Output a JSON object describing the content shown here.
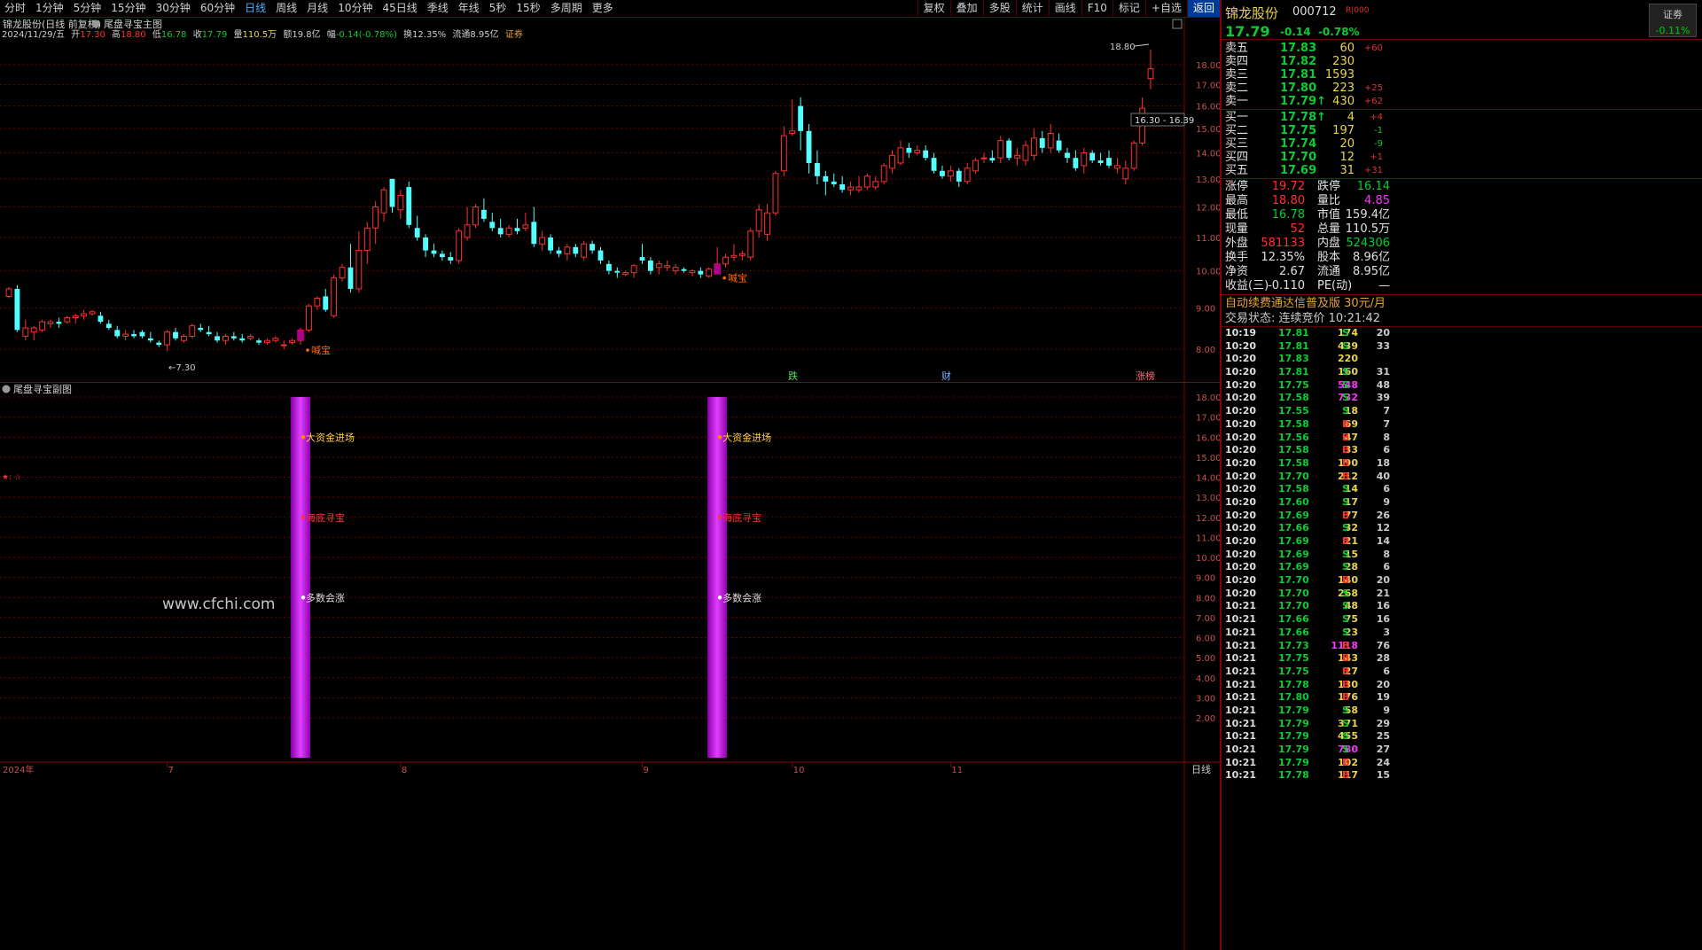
{
  "toolbar": {
    "periods": [
      "分时",
      "1分钟",
      "5分钟",
      "15分钟",
      "30分钟",
      "60分钟",
      "日线",
      "周线",
      "月线",
      "10分钟",
      "45日线",
      "季线",
      "年线",
      "5秒",
      "15秒",
      "多周期",
      "更多"
    ],
    "active_period": "日线",
    "tools": [
      "复权",
      "叠加",
      "多股",
      "统计",
      "画线",
      "F10",
      "标记",
      "+自选",
      "返回"
    ]
  },
  "main": {
    "title": "锦龙股份(日线 前复权)",
    "indicator": "尾盘寻宝主图",
    "info": {
      "date": "2024/11/29/五",
      "open_label": "开",
      "open": "17.30",
      "high_label": "高",
      "high": "18.80",
      "low_label": "低",
      "low": "16.78",
      "close_label": "收",
      "close": "17.79",
      "volume_label": "量",
      "volume": "110.5万",
      "amount_label": "额",
      "amount": "19.8亿",
      "change_label": "幅",
      "change": "-0.14(-0.78%)",
      "turnover_label": "换",
      "turnover": "12.35%",
      "float_label": "流通",
      "float": "8.95亿",
      "sector": "证券"
    },
    "high_mark": "18.80",
    "low_mark": "7.30",
    "range_label": "16.30 - 16.39",
    "signal_label": "喊宝",
    "event_tags": [
      "跌",
      "财",
      "涨榜"
    ]
  },
  "sub": {
    "title": "尾盘寻宝副图",
    "labels": [
      "大资金进场",
      "海底寻宝",
      "多数会涨"
    ],
    "watermark": "www.cfchi.com",
    "star_mark": "★: ☆"
  },
  "xaxis": {
    "year_label": "2024年",
    "months": [
      "7",
      "8",
      "9",
      "10",
      "11"
    ],
    "period_label": "日线"
  },
  "chart_data": {
    "type": "candlestick",
    "title": "锦龙股份(日线 前复权)",
    "y_axis_ticks": [
      "8.00",
      "9.00",
      "10.00",
      "11.00",
      "12.00",
      "13.00",
      "14.00",
      "15.00",
      "16.00",
      "17.00",
      "18.00"
    ],
    "ylim": [
      7.0,
      19.0
    ],
    "scale": "log",
    "up_color": "#ff3030",
    "down_color": "#54ffff",
    "x_months": [
      "7",
      "8",
      "9",
      "10",
      "11"
    ],
    "candles": [
      [
        9.3,
        9.55,
        9.25,
        9.5
      ],
      [
        9.5,
        9.6,
        8.4,
        8.45
      ],
      [
        8.3,
        8.7,
        8.2,
        8.5
      ],
      [
        8.4,
        8.55,
        8.2,
        8.5
      ],
      [
        8.45,
        8.7,
        8.4,
        8.65
      ],
      [
        8.6,
        8.7,
        8.5,
        8.65
      ],
      [
        8.65,
        8.75,
        8.5,
        8.6
      ],
      [
        8.65,
        8.8,
        8.6,
        8.75
      ],
      [
        8.75,
        8.85,
        8.6,
        8.8
      ],
      [
        8.8,
        8.95,
        8.7,
        8.85
      ],
      [
        8.85,
        8.95,
        8.8,
        8.9
      ],
      [
        8.8,
        8.9,
        8.6,
        8.65
      ],
      [
        8.6,
        8.7,
        8.45,
        8.5
      ],
      [
        8.45,
        8.55,
        8.25,
        8.3
      ],
      [
        8.3,
        8.45,
        8.2,
        8.35
      ],
      [
        8.35,
        8.45,
        8.25,
        8.3
      ],
      [
        8.4,
        8.45,
        8.25,
        8.3
      ],
      [
        8.25,
        8.4,
        8.15,
        8.2
      ],
      [
        8.15,
        8.2,
        8.05,
        8.1
      ],
      [
        8.1,
        8.45,
        7.95,
        8.4
      ],
      [
        8.4,
        8.5,
        8.2,
        8.25
      ],
      [
        8.2,
        8.35,
        8.15,
        8.3
      ],
      [
        8.3,
        8.6,
        8.25,
        8.55
      ],
      [
        8.5,
        8.6,
        8.4,
        8.45
      ],
      [
        8.4,
        8.55,
        8.3,
        8.35
      ],
      [
        8.3,
        8.4,
        8.15,
        8.2
      ],
      [
        8.2,
        8.35,
        8.1,
        8.3
      ],
      [
        8.3,
        8.4,
        8.2,
        8.25
      ],
      [
        8.25,
        8.35,
        8.15,
        8.2
      ],
      [
        8.25,
        8.35,
        8.2,
        8.3
      ],
      [
        8.2,
        8.25,
        8.1,
        8.15
      ],
      [
        8.15,
        8.25,
        8.1,
        8.2
      ],
      [
        8.2,
        8.3,
        8.15,
        8.25
      ],
      [
        8.1,
        8.2,
        8.0,
        8.1
      ],
      [
        8.15,
        8.25,
        8.1,
        8.2
      ],
      [
        8.2,
        8.5,
        8.1,
        8.45
      ],
      [
        8.45,
        9.1,
        8.4,
        9.05
      ],
      [
        9.05,
        9.3,
        8.95,
        9.25
      ],
      [
        9.3,
        9.5,
        8.9,
        8.95
      ],
      [
        8.8,
        9.9,
        8.75,
        9.8
      ],
      [
        9.8,
        10.2,
        9.7,
        10.1
      ],
      [
        10.1,
        10.8,
        9.4,
        9.5
      ],
      [
        9.5,
        11.2,
        9.4,
        10.6
      ],
      [
        10.6,
        11.5,
        10.2,
        11.3
      ],
      [
        11.3,
        12.2,
        10.8,
        12.0
      ],
      [
        11.8,
        12.7,
        11.5,
        12.6
      ],
      [
        13.0,
        13.0,
        11.8,
        12.0
      ],
      [
        11.9,
        12.6,
        11.6,
        12.4
      ],
      [
        12.7,
        12.9,
        11.3,
        11.4
      ],
      [
        11.3,
        11.7,
        10.9,
        11.0
      ],
      [
        11.0,
        11.1,
        10.4,
        10.6
      ],
      [
        10.6,
        10.8,
        10.4,
        10.5
      ],
      [
        10.5,
        10.6,
        10.3,
        10.4
      ],
      [
        10.4,
        10.55,
        10.2,
        10.3
      ],
      [
        10.3,
        11.3,
        10.2,
        11.2
      ],
      [
        11.0,
        12.0,
        10.9,
        11.4
      ],
      [
        11.4,
        12.1,
        11.3,
        12.0
      ],
      [
        11.9,
        12.3,
        11.5,
        11.6
      ],
      [
        11.5,
        11.8,
        11.2,
        11.3
      ],
      [
        11.3,
        11.6,
        11.0,
        11.1
      ],
      [
        11.1,
        11.4,
        11.0,
        11.3
      ],
      [
        11.3,
        11.6,
        11.1,
        11.2
      ],
      [
        11.3,
        11.8,
        11.2,
        11.4
      ],
      [
        11.5,
        12.0,
        10.7,
        10.8
      ],
      [
        10.8,
        11.2,
        10.6,
        11.0
      ],
      [
        11.0,
        11.1,
        10.5,
        10.6
      ],
      [
        10.6,
        10.7,
        10.4,
        10.5
      ],
      [
        10.5,
        10.8,
        10.3,
        10.7
      ],
      [
        10.7,
        10.8,
        10.4,
        10.5
      ],
      [
        10.4,
        10.9,
        10.3,
        10.8
      ],
      [
        10.8,
        10.9,
        10.5,
        10.6
      ],
      [
        10.6,
        10.7,
        10.2,
        10.3
      ],
      [
        10.2,
        10.3,
        9.9,
        10.0
      ],
      [
        10.0,
        10.1,
        9.8,
        9.95
      ],
      [
        9.9,
        10.0,
        9.85,
        9.95
      ],
      [
        9.95,
        10.2,
        9.8,
        10.15
      ],
      [
        10.4,
        10.8,
        10.2,
        10.3
      ],
      [
        10.3,
        10.4,
        9.9,
        10.0
      ],
      [
        10.1,
        10.3,
        9.9,
        10.2
      ],
      [
        10.1,
        10.3,
        10.0,
        10.15
      ],
      [
        10.0,
        10.2,
        9.9,
        10.1
      ],
      [
        10.05,
        10.1,
        9.95,
        10.0
      ],
      [
        9.95,
        10.05,
        9.85,
        10.0
      ],
      [
        10.0,
        10.1,
        9.8,
        9.9
      ],
      [
        9.85,
        10.1,
        9.8,
        10.05
      ],
      [
        10.0,
        10.7,
        9.95,
        10.2
      ],
      [
        10.2,
        10.5,
        10.1,
        10.4
      ],
      [
        10.4,
        10.8,
        10.3,
        10.45
      ],
      [
        10.45,
        10.6,
        10.3,
        10.5
      ],
      [
        10.4,
        11.3,
        10.3,
        11.2
      ],
      [
        11.2,
        12.1,
        11.0,
        11.9
      ],
      [
        11.1,
        12.1,
        10.9,
        11.8
      ],
      [
        11.8,
        13.3,
        11.7,
        13.2
      ],
      [
        13.3,
        15.1,
        13.1,
        14.7
      ],
      [
        14.8,
        16.3,
        14.7,
        14.9
      ],
      [
        16.0,
        16.4,
        14.1,
        14.9
      ],
      [
        14.9,
        15.2,
        13.2,
        13.6
      ],
      [
        13.6,
        14.1,
        12.8,
        13.1
      ],
      [
        13.1,
        13.3,
        12.4,
        12.9
      ],
      [
        12.9,
        13.2,
        12.7,
        12.8
      ],
      [
        12.8,
        13.1,
        12.5,
        12.6
      ],
      [
        12.6,
        12.9,
        12.4,
        12.7
      ],
      [
        12.6,
        13.1,
        12.5,
        12.7
      ],
      [
        12.7,
        13.2,
        12.6,
        13.1
      ],
      [
        12.7,
        13.1,
        12.6,
        12.9
      ],
      [
        12.9,
        13.6,
        12.8,
        13.5
      ],
      [
        13.4,
        14.1,
        13.2,
        13.9
      ],
      [
        13.6,
        14.5,
        13.5,
        14.2
      ],
      [
        14.2,
        14.4,
        13.8,
        14.0
      ],
      [
        14.0,
        14.3,
        13.9,
        14.1
      ],
      [
        14.1,
        14.3,
        13.7,
        13.8
      ],
      [
        13.8,
        14.0,
        13.2,
        13.3
      ],
      [
        13.3,
        13.5,
        13.0,
        13.1
      ],
      [
        13.1,
        13.5,
        12.9,
        13.3
      ],
      [
        13.3,
        13.4,
        12.7,
        12.9
      ],
      [
        12.9,
        13.6,
        12.8,
        13.4
      ],
      [
        13.3,
        13.8,
        13.2,
        13.7
      ],
      [
        13.8,
        14.0,
        13.6,
        13.8
      ],
      [
        13.8,
        14.1,
        13.6,
        13.7
      ],
      [
        13.8,
        14.7,
        13.6,
        14.5
      ],
      [
        14.5,
        14.6,
        13.7,
        13.8
      ],
      [
        13.8,
        14.2,
        13.5,
        13.9
      ],
      [
        13.7,
        14.5,
        13.5,
        14.3
      ],
      [
        13.9,
        15.0,
        13.7,
        14.6
      ],
      [
        14.6,
        14.9,
        14.0,
        14.2
      ],
      [
        14.2,
        15.2,
        14.0,
        14.8
      ],
      [
        14.5,
        14.8,
        14.0,
        14.1
      ],
      [
        14.0,
        14.2,
        13.6,
        13.8
      ],
      [
        13.8,
        14.1,
        13.3,
        13.4
      ],
      [
        13.5,
        14.2,
        13.2,
        14.0
      ],
      [
        14.0,
        14.1,
        13.6,
        13.7
      ],
      [
        13.7,
        14.0,
        13.5,
        13.6
      ],
      [
        13.8,
        14.1,
        13.4,
        13.5
      ],
      [
        13.4,
        13.8,
        13.2,
        13.5
      ],
      [
        13.0,
        13.7,
        12.8,
        13.4
      ],
      [
        13.4,
        14.5,
        13.3,
        14.4
      ],
      [
        14.4,
        16.4,
        14.3,
        15.9
      ],
      [
        17.3,
        18.8,
        16.78,
        17.79
      ]
    ],
    "signals": [
      {
        "index": 35,
        "label": "喊宝"
      },
      {
        "index": 85,
        "label": "喊宝"
      }
    ],
    "sub_chart": {
      "title": "尾盘寻宝副图",
      "y_axis_ticks": [
        "2.00",
        "3.00",
        "4.00",
        "5.00",
        "6.00",
        "7.00",
        "8.00",
        "9.00",
        "10.00",
        "11.00",
        "12.00",
        "13.00",
        "14.00",
        "15.00",
        "16.00",
        "17.00",
        "18.00"
      ],
      "signal_bars_at": [
        35,
        85
      ],
      "labels": [
        "大资金进场",
        "海底寻宝",
        "多数会涨"
      ]
    }
  },
  "quote": {
    "name": "锦龙股份",
    "code": "000712",
    "r_tag": "R|000",
    "btn_label": "证劵",
    "btn_change": "-0.11%",
    "price": "17.79",
    "change": "-0.14",
    "change_pct": "-0.78%",
    "asks": [
      {
        "label": "卖五",
        "price": "17.83",
        "vol": "60",
        "delta": "+60"
      },
      {
        "label": "卖四",
        "price": "17.82",
        "vol": "230",
        "delta": ""
      },
      {
        "label": "卖三",
        "price": "17.81",
        "vol": "1593",
        "delta": ""
      },
      {
        "label": "卖二",
        "price": "17.80",
        "vol": "223",
        "delta": "+25"
      },
      {
        "label": "卖一",
        "price": "17.79↑",
        "vol": "430",
        "delta": "+62"
      }
    ],
    "bids": [
      {
        "label": "买一",
        "price": "17.78↑",
        "vol": "4",
        "delta": "+4"
      },
      {
        "label": "买二",
        "price": "17.75",
        "vol": "197",
        "delta": "-1"
      },
      {
        "label": "买三",
        "price": "17.74",
        "vol": "20",
        "delta": "-9"
      },
      {
        "label": "买四",
        "price": "17.70",
        "vol": "12",
        "delta": "+1"
      },
      {
        "label": "买五",
        "price": "17.69",
        "vol": "31",
        "delta": "+31"
      }
    ],
    "stats": [
      {
        "l1": "涨停",
        "v1": "19.72",
        "c1": "#ff3030",
        "l2": "跌停",
        "v2": "16.14",
        "c2": "#0dcc33"
      },
      {
        "l1": "最高",
        "v1": "18.80",
        "c1": "#ff3030",
        "l2": "量比",
        "v2": "4.85",
        "c2": "#ff33ff"
      },
      {
        "l1": "最低",
        "v1": "16.78",
        "c1": "#0dcc33",
        "l2": "市值",
        "v2": "159.4亿",
        "c2": "#e0e0e0"
      },
      {
        "l1": "现量",
        "v1": "52",
        "c1": "#ff3030",
        "l2": "总量",
        "v2": "110.5万",
        "c2": "#e0e0e0"
      },
      {
        "l1": "外盘",
        "v1": "581133",
        "c1": "#ff3030",
        "l2": "内盘",
        "v2": "524306",
        "c2": "#0dcc33"
      },
      {
        "l1": "换手",
        "v1": "12.35%",
        "c1": "#e0e0e0",
        "l2": "股本",
        "v2": "8.96亿",
        "c2": "#e0e0e0"
      },
      {
        "l1": "净资",
        "v1": "2.67",
        "c1": "#e0e0e0",
        "l2": "流通",
        "v2": "8.95亿",
        "c2": "#e0e0e0"
      },
      {
        "l1": "收益(三)",
        "v1": "-0.110",
        "c1": "#e0e0e0",
        "l2": "PE(动)",
        "v2": "—",
        "c2": "#e0e0e0"
      }
    ],
    "banner": "自动续费通达信普及版 30元/月",
    "status": "交易状态: 连续竞价 10:21:42",
    "ticks": [
      [
        "10:19",
        "17.81",
        "174",
        "S",
        "20"
      ],
      [
        "10:20",
        "17.81",
        "439",
        "S",
        "33"
      ],
      [
        "10:20",
        "17.83",
        "220",
        "",
        ""
      ],
      [
        "10:20",
        "17.81",
        "160",
        "S",
        "31"
      ],
      [
        "10:20",
        "17.75",
        "548",
        "S",
        "48"
      ],
      [
        "10:20",
        "17.58",
        "732",
        "S",
        "39"
      ],
      [
        "10:20",
        "17.55",
        "18",
        "S",
        "7"
      ],
      [
        "10:20",
        "17.58",
        "69",
        "B",
        "7"
      ],
      [
        "10:20",
        "17.56",
        "47",
        "B",
        "8"
      ],
      [
        "10:20",
        "17.58",
        "33",
        "B",
        "6"
      ],
      [
        "10:20",
        "17.58",
        "190",
        "B",
        "18"
      ],
      [
        "10:20",
        "17.70",
        "212",
        "B",
        "40"
      ],
      [
        "10:20",
        "17.58",
        "14",
        "S",
        "6"
      ],
      [
        "10:20",
        "17.60",
        "17",
        "S",
        "9"
      ],
      [
        "10:20",
        "17.69",
        "77",
        "B",
        "26"
      ],
      [
        "10:20",
        "17.66",
        "32",
        "S",
        "12"
      ],
      [
        "10:20",
        "17.69",
        "21",
        "B",
        "14"
      ],
      [
        "10:20",
        "17.69",
        "15",
        "S",
        "8"
      ],
      [
        "10:20",
        "17.69",
        "28",
        "S",
        "6"
      ],
      [
        "10:20",
        "17.70",
        "140",
        "B",
        "20"
      ],
      [
        "10:20",
        "17.70",
        "268",
        "S",
        "21"
      ],
      [
        "10:21",
        "17.70",
        "48",
        "S",
        "16"
      ],
      [
        "10:21",
        "17.66",
        "75",
        "S",
        "16"
      ],
      [
        "10:21",
        "17.66",
        "23",
        "S",
        "3"
      ],
      [
        "10:21",
        "17.73",
        "1118",
        "B",
        "76"
      ],
      [
        "10:21",
        "17.75",
        "143",
        "B",
        "28"
      ],
      [
        "10:21",
        "17.75",
        "27",
        "B",
        "6"
      ],
      [
        "10:21",
        "17.78",
        "130",
        "B",
        "20"
      ],
      [
        "10:21",
        "17.80",
        "176",
        "B",
        "19"
      ],
      [
        "10:21",
        "17.79",
        "58",
        "S",
        "9"
      ],
      [
        "10:21",
        "17.79",
        "371",
        "S",
        "29"
      ],
      [
        "10:21",
        "17.79",
        "455",
        "S",
        "25"
      ],
      [
        "10:21",
        "17.79",
        "780",
        "S",
        "27"
      ],
      [
        "10:21",
        "17.79",
        "102",
        "B",
        "24"
      ],
      [
        "10:21",
        "17.78",
        "117",
        "B",
        "15"
      ]
    ]
  }
}
